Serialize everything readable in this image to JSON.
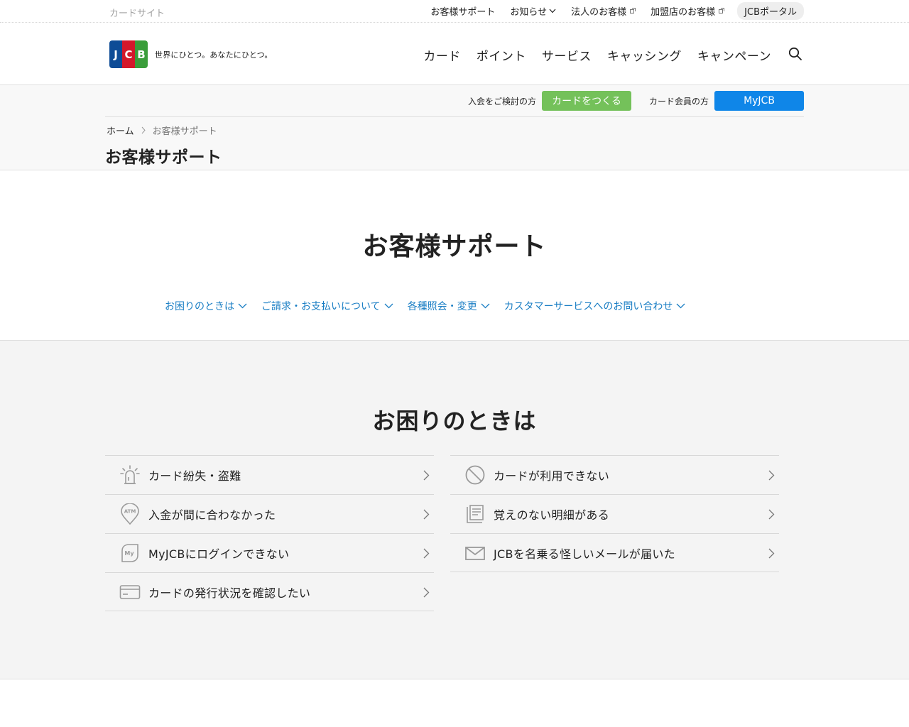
{
  "topbar": {
    "site_label": "カードサイト",
    "links": [
      {
        "label": "お客様サポート"
      },
      {
        "label": "お知らせ"
      },
      {
        "label": "法人のお客様"
      },
      {
        "label": "加盟店のお客様"
      }
    ],
    "portal_label": "JCBポータル"
  },
  "header": {
    "logo_letters": [
      "J",
      "C",
      "B"
    ],
    "tagline": "世界にひとつ。あなたにひとつ。",
    "nav": [
      "カード",
      "ポイント",
      "サービス",
      "キャッシング",
      "キャンペーン"
    ],
    "search_icon": "search-icon"
  },
  "subhead": {
    "join_label": "入会をご検討の方",
    "join_button": "カードをつくる",
    "member_label": "カード会員の方",
    "member_button": "MyJCB",
    "breadcrumb": {
      "home": "ホーム",
      "current": "お客様サポート"
    },
    "page_title": "お客様サポート"
  },
  "hero": {
    "title": "お客様サポート",
    "anchors": [
      "お困りのときは",
      "ご請求・お支払いについて",
      "各種照会・変更",
      "カスタマーサービスへのお問い合わせ"
    ]
  },
  "trouble": {
    "title": "お困りのときは",
    "left": [
      {
        "label": "カード紛失・盗難",
        "icon": "alarm-light-icon"
      },
      {
        "label": "入金が間に合わなかった",
        "icon": "atm-pin-icon",
        "icon_text": "ATM"
      },
      {
        "label": "MyJCBにログインできない",
        "icon": "myjcb-leaf-icon",
        "icon_text": "My"
      },
      {
        "label": "カードの発行状況を確認したい",
        "icon": "card-icon"
      }
    ],
    "right": [
      {
        "label": "カードが利用できない",
        "icon": "prohibited-icon"
      },
      {
        "label": "覚えのない明細がある",
        "icon": "statement-icon"
      },
      {
        "label": "JCBを名乗る怪しいメールが届いた",
        "icon": "mail-icon"
      }
    ]
  },
  "colors": {
    "green": "#74c15a",
    "blue": "#0f86e8",
    "link": "#1a7ec4",
    "icon_gray": "#9a9a9a"
  }
}
